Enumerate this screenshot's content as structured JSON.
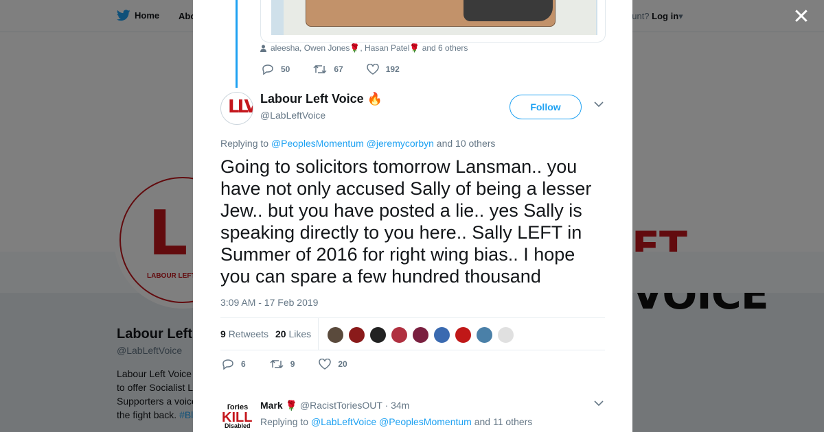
{
  "background": {
    "nav": {
      "home": "Home",
      "about": "Abo",
      "account_prompt": "ccount?",
      "login": "Log in"
    },
    "banner_left": "FT",
    "banner_right": "VOICE",
    "avatar_sub": "LABOUR LEFT",
    "profile_name": "Labour Left",
    "profile_handle": "@LabLeftVoice",
    "bio": [
      "Labour Left Voice",
      "to offer Socialist L",
      "Supporters a voice",
      "the fight back. "
    ],
    "bio_tag": "#Bl"
  },
  "modal": {
    "prev_tweet": {
      "likers": [
        {
          "name": "aleesha, Owen Jones"
        },
        {
          "name": ", Hasan Patel"
        },
        {
          "name": " and 6 others"
        }
      ],
      "replies": "50",
      "retweets": "67",
      "likes": "192"
    },
    "tweet": {
      "author_name": "Labour Left Voice",
      "author_emoji": "🔥",
      "author_handle": "@LabLeftVoice",
      "follow_label": "Follow",
      "replying_prefix": "Replying to ",
      "replying_user1": "@PeoplesMomentum",
      "replying_user2": "@jeremycorbyn",
      "replying_suffix": " and 10 others",
      "text": "Going to solicitors tomorrow Lansman.. you have not only accused Sally of being a lesser Jew.. but you have posted a lie.. yes Sally is speaking directly to you here.. Sally LEFT in Summer of 2016 for right wing bias.. I hope you can spare a few hundred thousand",
      "timestamp": "3:09 AM - 17 Feb 2019",
      "retweets_count": "9",
      "retweets_label": "Retweets",
      "likes_count": "20",
      "likes_label": "Likes",
      "face_colors": [
        "#5a4a3c",
        "#8a1a1a",
        "#222222",
        "#b03040",
        "#7a2040",
        "#3a6ab0",
        "#c01818",
        "#4a80a8",
        "#e0e0e0"
      ],
      "replies": "6",
      "retweets": "9",
      "likes": "20"
    },
    "reply": {
      "avatar_top": "Tories",
      "avatar_mid": "KILL",
      "avatar_bottom": "Disabled",
      "name": "Mark",
      "handle": "@RacistToriesOUT",
      "time": "· 34m",
      "replying_prefix": "Replying to ",
      "user1": "@LabLeftVoice",
      "user2": "@PeoplesMomentum",
      "suffix": " and 11 others"
    }
  }
}
